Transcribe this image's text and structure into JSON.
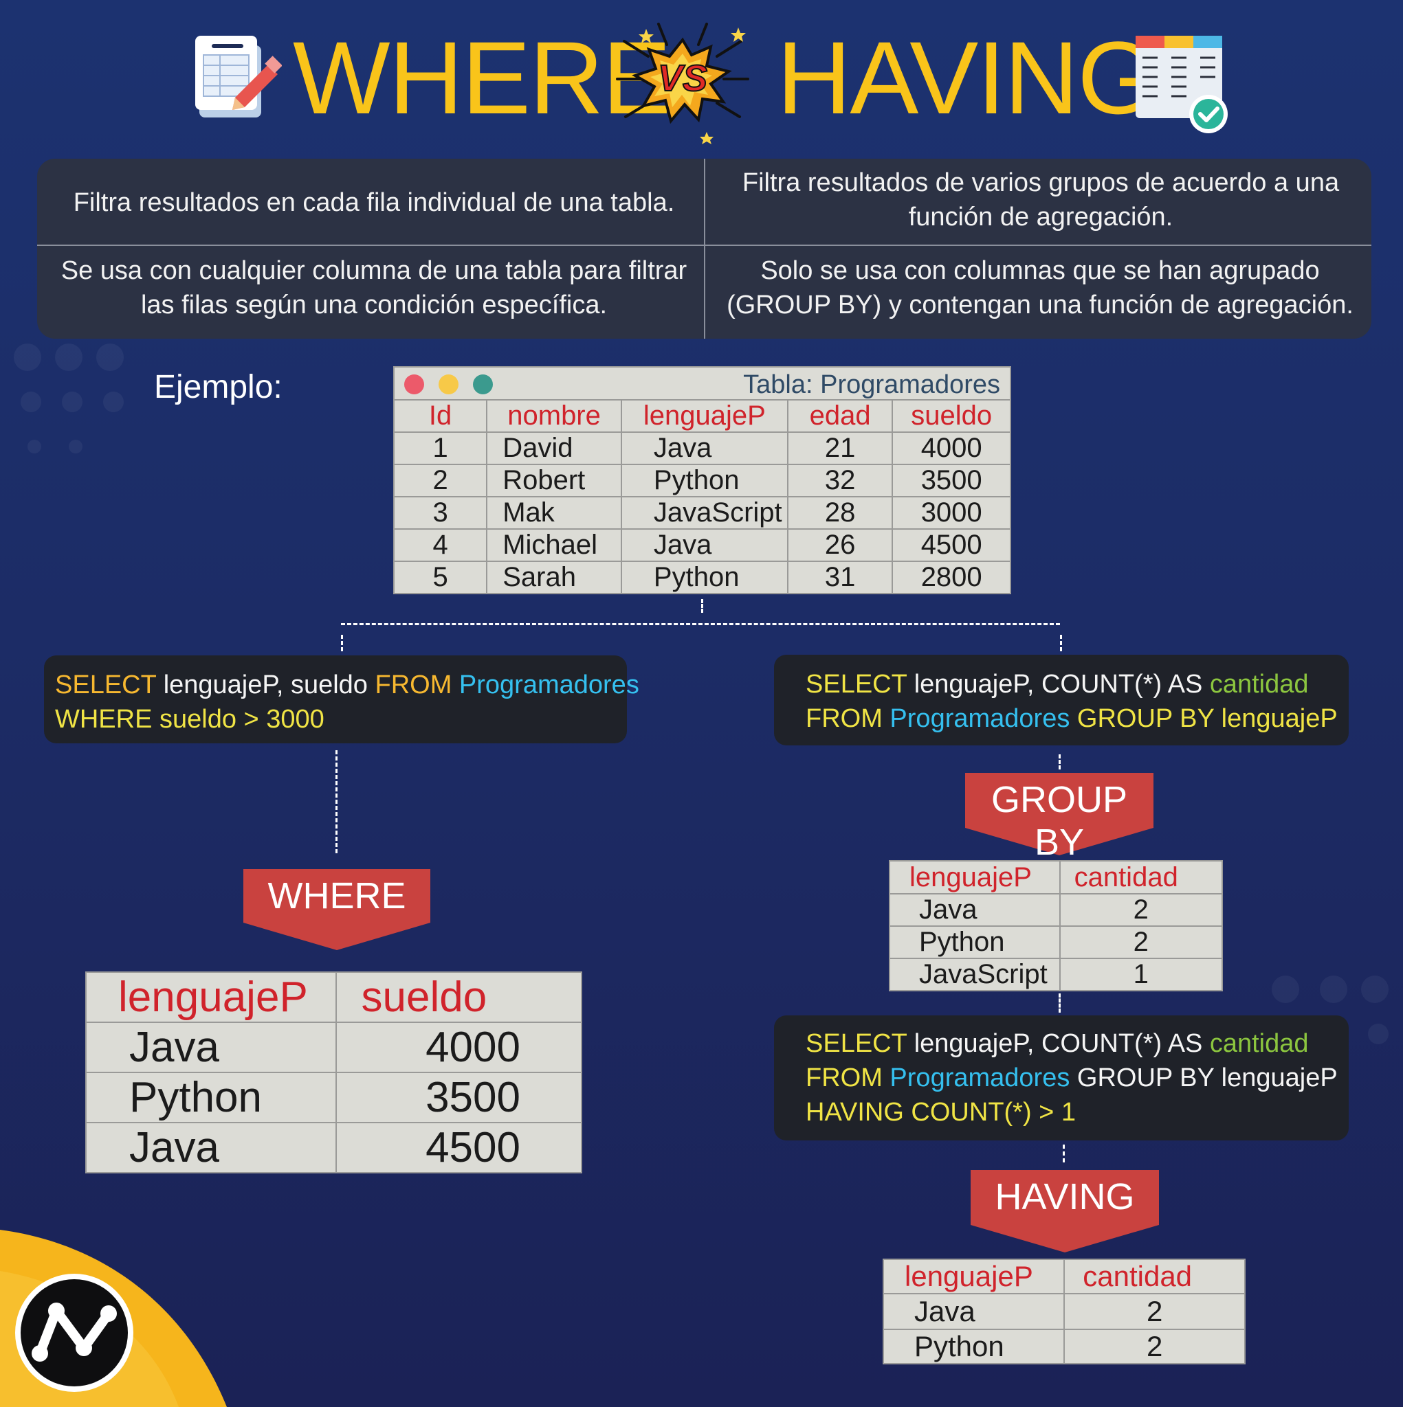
{
  "title": {
    "left": "WHERE",
    "vs": "VS",
    "right": "HAVING"
  },
  "comparison": [
    {
      "where": "Filtra resultados en cada fila individual de una tabla.",
      "having": "Filtra resultados de varios grupos de acuerdo a una función de agregación."
    },
    {
      "where": "Se usa con cualquier columna de una tabla para filtrar las filas según una condición específica.",
      "having": "Solo se usa con columnas que se han agrupado (GROUP BY) y contengan una función de agregación."
    }
  ],
  "example_label": "Ejemplo:",
  "source_table": {
    "title": "Tabla: Programadores",
    "headers": [
      "Id",
      "nombre",
      "lenguajeP",
      "edad",
      "sueldo"
    ],
    "rows": [
      [
        "1",
        "David",
        "Java",
        "21",
        "4000"
      ],
      [
        "2",
        "Robert",
        "Python",
        "32",
        "3500"
      ],
      [
        "3",
        "Mak",
        "JavaScript",
        "28",
        "3000"
      ],
      [
        "4",
        "Michael",
        "Java",
        "26",
        "4500"
      ],
      [
        "5",
        "Sarah",
        "Python",
        "31",
        "2800"
      ]
    ]
  },
  "where_query": {
    "l1_select": "SELECT",
    "l1_cols": " lenguajeP, sueldo ",
    "l1_from": "FROM",
    "l1_table": " Programadores",
    "l2": "WHERE sueldo > 3000"
  },
  "group_query": {
    "l1_select": "SELECT",
    "l1_cols": " lenguajeP, COUNT(*) AS ",
    "l1_alias": "cantidad",
    "l2_from": "FROM",
    "l2_table": " Programadores",
    "l2_rest": " GROUP BY  lenguajeP"
  },
  "having_query": {
    "l1_select": "SELECT",
    "l1_cols": " lenguajeP, COUNT(*) AS ",
    "l1_alias": "cantidad",
    "l2_from": "FROM",
    "l2_table": " Programadores",
    "l2_rest": " GROUP BY  lenguajeP",
    "l3": "HAVING COUNT(*) > 1"
  },
  "banners": {
    "where": "WHERE",
    "group_by": "GROUP BY",
    "having": "HAVING"
  },
  "where_result": {
    "headers": [
      "lenguajeP",
      "sueldo"
    ],
    "rows": [
      [
        "Java",
        "4000"
      ],
      [
        "Python",
        "3500"
      ],
      [
        "Java",
        "4500"
      ]
    ]
  },
  "group_result": {
    "headers": [
      "lenguajeP",
      "cantidad"
    ],
    "rows": [
      [
        "Java",
        "2"
      ],
      [
        "Python",
        "2"
      ],
      [
        "JavaScript",
        "1"
      ]
    ]
  },
  "having_result": {
    "headers": [
      "lenguajeP",
      "cantidad"
    ],
    "rows": [
      [
        "Java",
        "2"
      ],
      [
        "Python",
        "2"
      ]
    ]
  },
  "colors": {
    "title": "#f9c41a",
    "banner": "#c9423f",
    "header_text": "#d0232b",
    "table_bg": "#dcdcd6",
    "code_bg": "#1f2229"
  }
}
